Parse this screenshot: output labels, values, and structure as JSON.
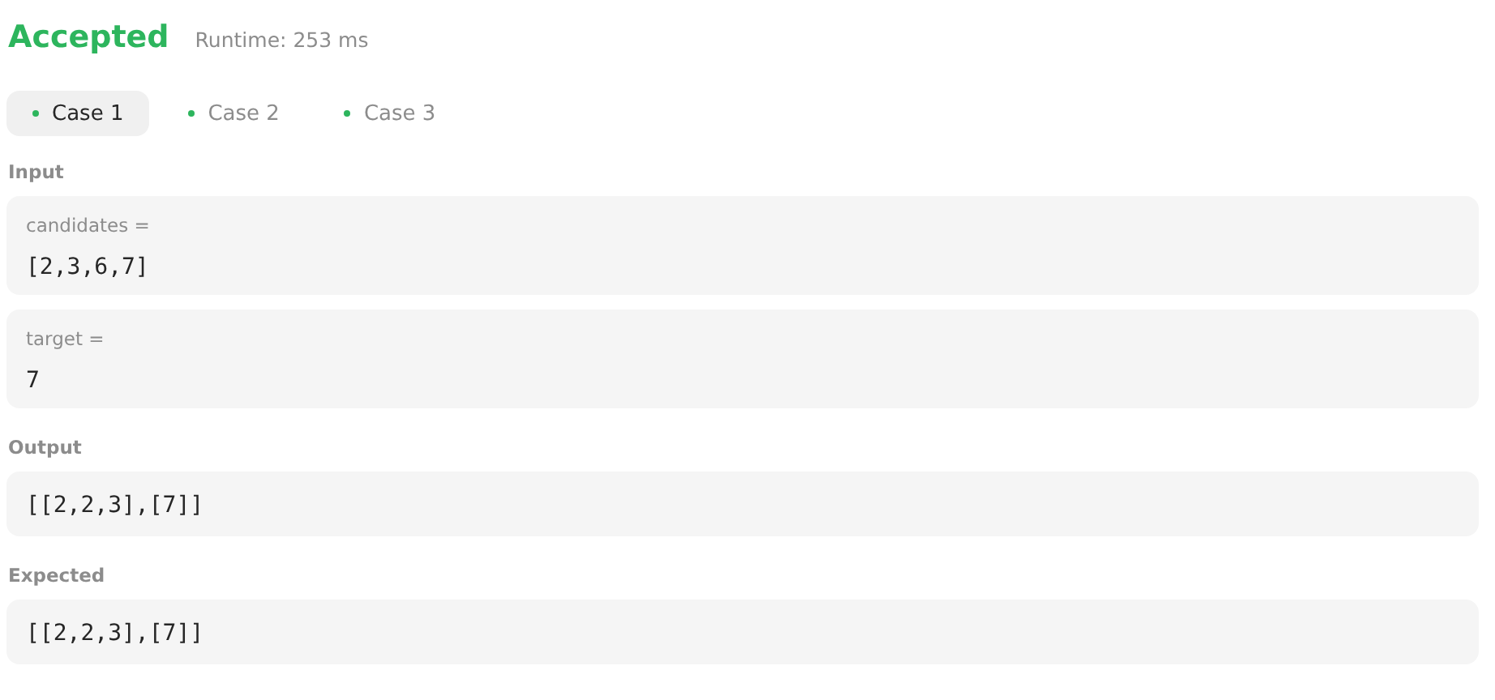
{
  "result": {
    "status": "Accepted",
    "runtime": "Runtime: 253 ms"
  },
  "cases": [
    {
      "label": "Case 1",
      "selected": true,
      "color": "#2db55d"
    },
    {
      "label": "Case 2",
      "selected": false,
      "color": "#2db55d"
    },
    {
      "label": "Case 3",
      "selected": false,
      "color": "#2db55d"
    }
  ],
  "input": {
    "label": "Input",
    "params": [
      {
        "name": "candidates =",
        "value": "[2,3,6,7]"
      },
      {
        "name": "target =",
        "value": "7"
      }
    ]
  },
  "output": {
    "label": "Output",
    "value": "[[2,2,3],[7]]"
  },
  "expected": {
    "label": "Expected",
    "value": "[[2,2,3],[7]]"
  }
}
